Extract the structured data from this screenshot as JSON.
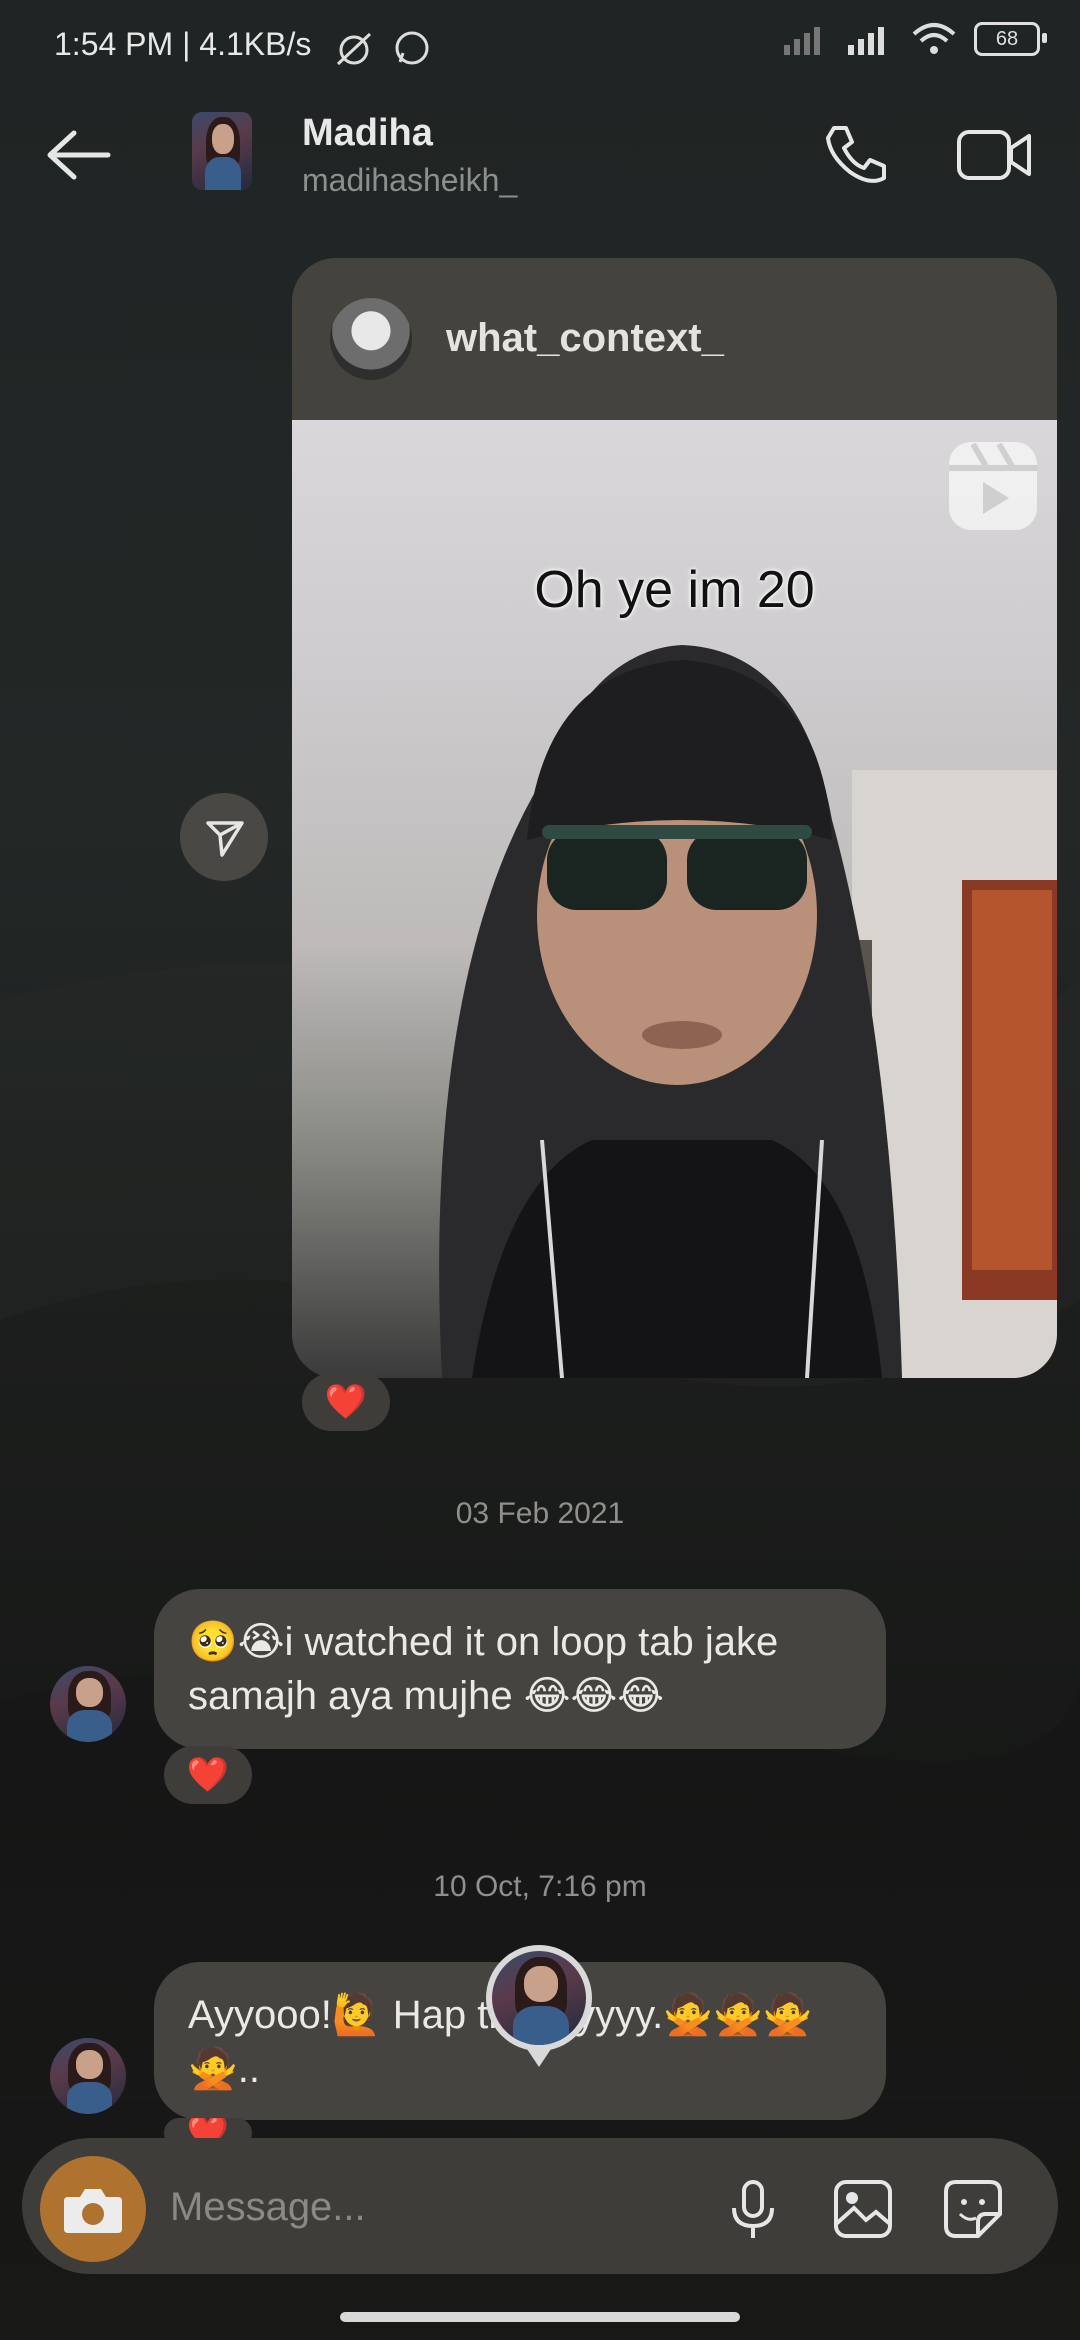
{
  "status_bar": {
    "text": "1:54 PM | 4.1KB/s",
    "battery": "68"
  },
  "header": {
    "name": "Madiha",
    "username": "madihasheikh_"
  },
  "post": {
    "username": "what_context_",
    "caption": "Oh ye im 20",
    "reaction": "❤️"
  },
  "messages": [
    {
      "date": "03 Feb 2021",
      "text": "🥺😭i watched it on loop tab jake samajh aya mujhe 😂😂😂",
      "reaction": "❤️"
    },
    {
      "date": "10 Oct, 7:16 pm",
      "text": "Ayyooo!🙋 Hap thdayyyyy.🙅🙅🙅🙅..",
      "reaction": "❤️"
    }
  ],
  "composer": {
    "placeholder": "Message..."
  },
  "colors": {
    "accent_camera": "#b0732f",
    "bubble": "#464440",
    "heart": "#e53935"
  }
}
